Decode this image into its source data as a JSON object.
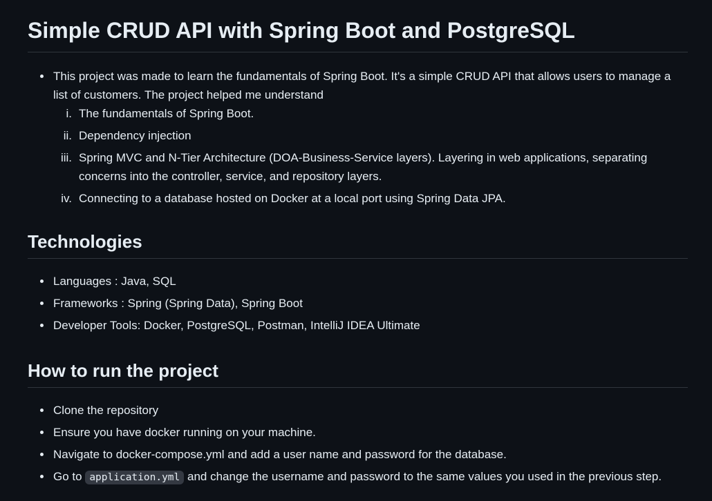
{
  "title": "Simple CRUD API with Spring Boot and PostgreSQL",
  "intro": {
    "text": "This project was made to learn the fundamentals of Spring Boot. It's a simple CRUD API that allows users to manage a list of customers. The project helped me understand",
    "numerals": [
      "i.",
      "ii.",
      "iii.",
      "iv."
    ],
    "items": [
      "The fundamentals of Spring Boot.",
      "Dependency injection",
      "Spring MVC and N-Tier Architecture (DOA-Business-Service layers). Layering in web applications, separating concerns into the controller, service, and repository layers.",
      "Connecting to a database hosted on Docker at a local port using Spring Data JPA."
    ]
  },
  "technologies": {
    "heading": "Technologies",
    "items": [
      "Languages : Java, SQL",
      "Frameworks : Spring (Spring Data), Spring Boot",
      "Developer Tools: Docker, PostgreSQL, Postman, IntelliJ IDEA Ultimate"
    ]
  },
  "run": {
    "heading": "How to run the project",
    "items": [
      "Clone the repository",
      "Ensure you have docker running on your machine.",
      "Navigate to docker-compose.yml and add a user name and password for the database."
    ],
    "step4": {
      "before": "Go to ",
      "code": "application.yml",
      "after": " and change the username and password to the same values you used in the previous step."
    }
  }
}
